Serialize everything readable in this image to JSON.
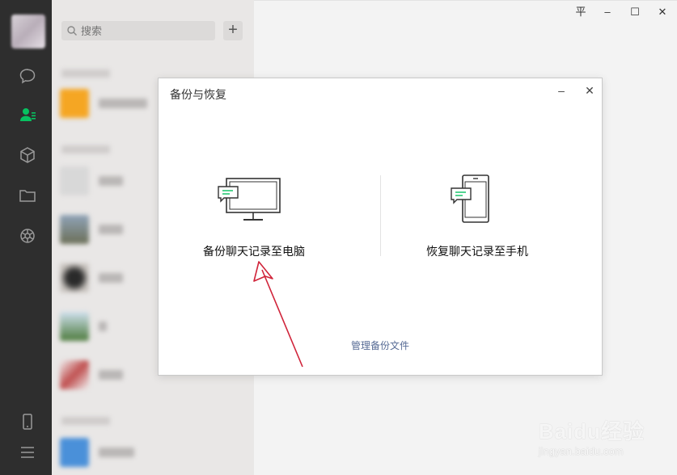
{
  "search": {
    "placeholder": "搜索"
  },
  "list": {
    "add_label": "+"
  },
  "window_controls": {
    "pin": "平",
    "minimize": "–",
    "maximize": "☐",
    "close": "✕"
  },
  "dialog": {
    "title": "备份与恢复",
    "minimize": "–",
    "close": "✕",
    "backup_option": {
      "label": "备份聊天记录至电脑",
      "icon": "monitor-chat-icon"
    },
    "restore_option": {
      "label": "恢复聊天记录至手机",
      "icon": "phone-chat-icon"
    },
    "manage_link": "管理备份文件"
  },
  "watermark": {
    "logo": "Baidu经验",
    "url": "jingyan.baidu.com"
  },
  "colors": {
    "accent": "#07c160",
    "link": "#576b95",
    "arrow": "#d0243a",
    "nav_bg": "#2e2e2e"
  }
}
